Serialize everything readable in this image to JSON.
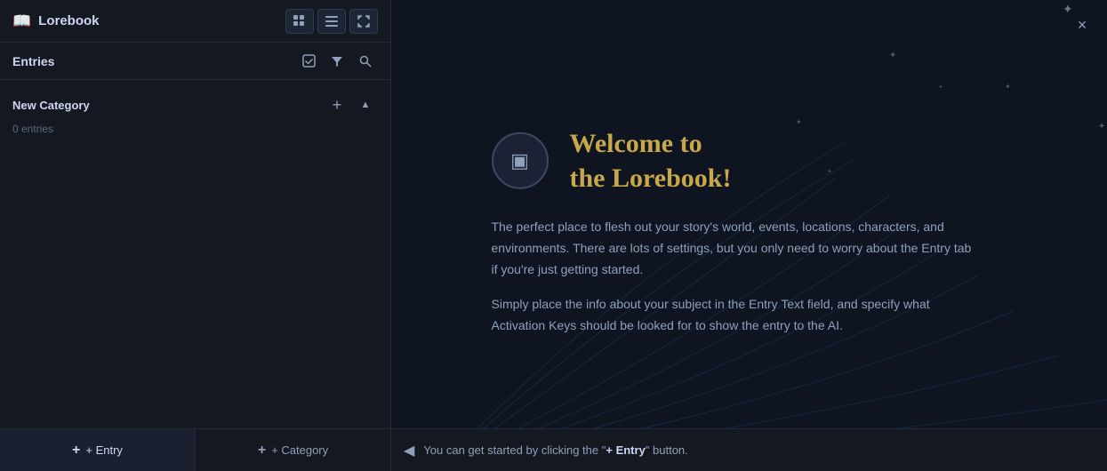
{
  "sidebar": {
    "title": "Lorebook",
    "book_icon": "📖",
    "header_buttons": [
      {
        "label": "⊞",
        "name": "grid-view-button",
        "active": false
      },
      {
        "label": "☰",
        "name": "list-view-button",
        "active": false
      },
      {
        "label": "⤢",
        "name": "expand-button",
        "active": false
      }
    ],
    "entries_label": "Entries",
    "entries_action_buttons": [
      {
        "label": "☑",
        "name": "check-icon"
      },
      {
        "label": "⚡",
        "name": "filter-icon"
      },
      {
        "label": "🔍",
        "name": "search-icon"
      }
    ],
    "category": {
      "name": "New Category",
      "entries_count": "0 entries",
      "action_buttons": [
        {
          "label": "+",
          "name": "add-to-category-button"
        },
        {
          "label": "▲",
          "name": "collapse-category-button"
        }
      ]
    },
    "bottom": {
      "add_entry_label": "+ Entry",
      "add_category_label": "+ Category"
    }
  },
  "main": {
    "welcome_title_line1": "Welcome to",
    "welcome_title_line2": "the Lorebook!",
    "description1": "The perfect place to flesh out your story's world, events, locations, characters, and environments. There are lots of settings, but you only need to worry about the Entry tab if you're just getting started.",
    "description2": "Simply place the info about your subject in the Entry Text field, and specify what Activation Keys should be looked for to show the entry to the AI.",
    "hint_text_before": "You can get started by clicking the \"",
    "hint_text_button": "+ Entry",
    "hint_text_after": "\" button.",
    "icon_inner": "▣",
    "close_label": "×"
  },
  "colors": {
    "accent_gold": "#c8a84b",
    "sidebar_bg": "#141820",
    "main_bg": "#0e1420",
    "text_primary": "#cdd6f4",
    "text_secondary": "#8fa0bb",
    "border": "#232a38"
  }
}
